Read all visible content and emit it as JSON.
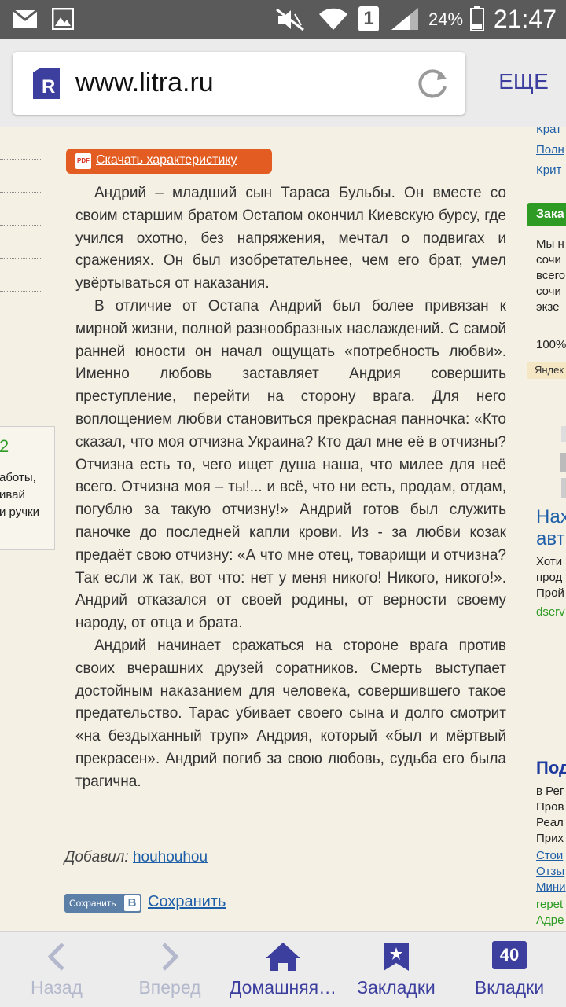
{
  "status_bar": {
    "time": "21:47",
    "battery": "24%",
    "sim": "1"
  },
  "browser": {
    "url": "www.litra.ru",
    "more_label": "ЕЩЕ"
  },
  "page": {
    "download_label": "Скачать характеристику",
    "paragraphs": [
      "Андрий – младший сын Тараса Бульбы. Он вместе со своим старшим братом Остапом окончил Киевскую бурсу, где учился охотно, без напряжения, мечтал о подвигах и сражениях. Он был изобретательнее, чем его брат, умел увёртываться от наказания.",
      "В отличие от Остапа Андрий был более привязан к мирной жизни, полной разнообразных наслаждений. С самой ранней юности он начал ощущать «потребность любви». Именно любовь заставляет Андрия совершить преступление, перейти на сторону врага. Для него воплощением любви становиться прекрасная панночка: «Кто сказал, что моя отчизна Украина? Кто дал мне её в отчизны? Отчизна есть то, чего ищет душа наша, что милее для неё всего. Отчизна моя – ты!... и всё, что ни есть, продам, отдам, погублю за такую отчизну!» Андрий готов был служить паночке до последней капли крови. Из - за любви козак предаёт свою отчизну: «А что мне отец, товарищи и отчизна? Так если ж так, вот что: нет у меня никого! Никого, никого!». Андрий отказался от своей родины, от верности своему народу, от отца и брата.",
      "Андрий начинает сражаться на стороне врага против своих вчерашних друзей соратников. Смерть выступает достойным наказанием для человека, совершившего такое предательство. Тарас убивает своего сына и долго смотрит «на бездыханный труп» Андрия, который «был и мёртвый прекрасен». Андрий погиб за свою любовь, судьба его была трагична."
    ],
    "author_label": "Добавил:",
    "author_name": "houhouhou",
    "vk_button_label": "Сохранить",
    "vk_badge": "B",
    "save_link": "Сохранить",
    "left_box": {
      "title": "2",
      "lines": [
        "аботы,",
        "ивай",
        "и ручки"
      ]
    },
    "right_column": {
      "links_top": [
        "Крат",
        "Полн",
        "Крит"
      ],
      "zak": "Зака",
      "promo_lines": [
        "Мы н",
        "сочи",
        "всего",
        "сочи",
        "экзе"
      ],
      "percent": "100%",
      "yandex": "Яндек",
      "ad1_title": [
        "Нах",
        "авт"
      ],
      "ad1_lines": [
        "Хоти",
        "прод",
        "Прой"
      ],
      "ad1_domain": "dserv",
      "ad2_title": "Под",
      "ad2_lines": [
        "в Рег",
        "Пров",
        "Реал",
        "Прих"
      ],
      "ad2_links": [
        "Стои",
        "Отзы",
        "Мини"
      ],
      "ad2_domain": "repet",
      "ad2_address": "Адре"
    }
  },
  "bottom_nav": {
    "back": "Назад",
    "forward": "Вперед",
    "home": "Домашняя…",
    "bookmarks": "Закладки",
    "tabs": "Вкладки",
    "tabs_count": "40"
  }
}
